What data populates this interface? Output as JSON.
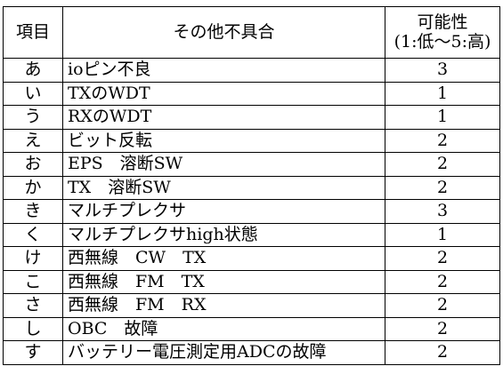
{
  "header": {
    "item": "項目",
    "description": "その他不具合",
    "probability_line1": "可能性",
    "probability_line2": "(1:低～5:高)"
  },
  "rows": [
    {
      "item": "あ",
      "description": "ioピン不良",
      "probability": "3"
    },
    {
      "item": "い",
      "description": "TXのWDT",
      "probability": "1"
    },
    {
      "item": "う",
      "description": "RXのWDT",
      "probability": "1"
    },
    {
      "item": "え",
      "description": "ビット反転",
      "probability": "2"
    },
    {
      "item": "お",
      "description": "EPS　溶断SW",
      "probability": "2"
    },
    {
      "item": "か",
      "description": "TX　溶断SW",
      "probability": "2"
    },
    {
      "item": "き",
      "description": "マルチプレクサ",
      "probability": "3"
    },
    {
      "item": "く",
      "description": "マルチプレクサhigh状態",
      "probability": "1"
    },
    {
      "item": "け",
      "description": "西無線　CW　TX",
      "probability": "2"
    },
    {
      "item": "こ",
      "description": "西無線　FM　TX",
      "probability": "2"
    },
    {
      "item": "さ",
      "description": "西無線　FM　RX",
      "probability": "2"
    },
    {
      "item": "し",
      "description": "OBC　故障",
      "probability": "2"
    },
    {
      "item": "す",
      "description": "バッテリー電圧測定用ADCの故障",
      "probability": "2"
    }
  ]
}
